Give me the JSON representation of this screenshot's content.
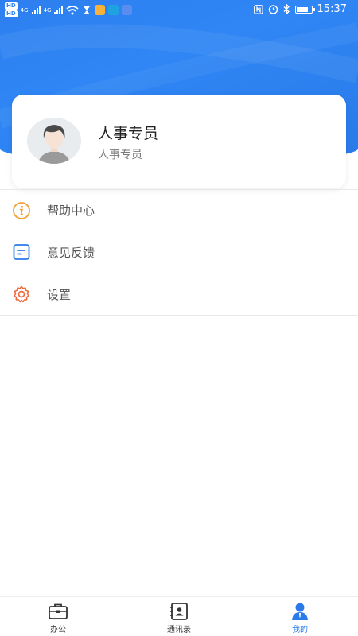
{
  "status_bar": {
    "hd1": "HD",
    "hd2": "HD",
    "net1": "4G",
    "net2": "4G",
    "time": "15:37",
    "battery_level": 0.8
  },
  "profile": {
    "name": "人事专员",
    "role": "人事专员"
  },
  "menu": {
    "items": [
      {
        "label": "帮助中心",
        "icon": "info-icon",
        "color": "#f0a23a"
      },
      {
        "label": "意见反馈",
        "icon": "feedback-icon",
        "color": "#2a7ae9"
      },
      {
        "label": "设置",
        "icon": "gear-icon",
        "color": "#ef6a3c"
      }
    ]
  },
  "bottom_nav": {
    "items": [
      {
        "label": "办公",
        "icon": "briefcase-icon",
        "active": false
      },
      {
        "label": "通讯录",
        "icon": "contacts-icon",
        "active": false
      },
      {
        "label": "我的",
        "icon": "user-icon",
        "active": true
      }
    ]
  },
  "colors": {
    "brand": "#2f86f4",
    "active_tab": "#2a7ae9"
  }
}
